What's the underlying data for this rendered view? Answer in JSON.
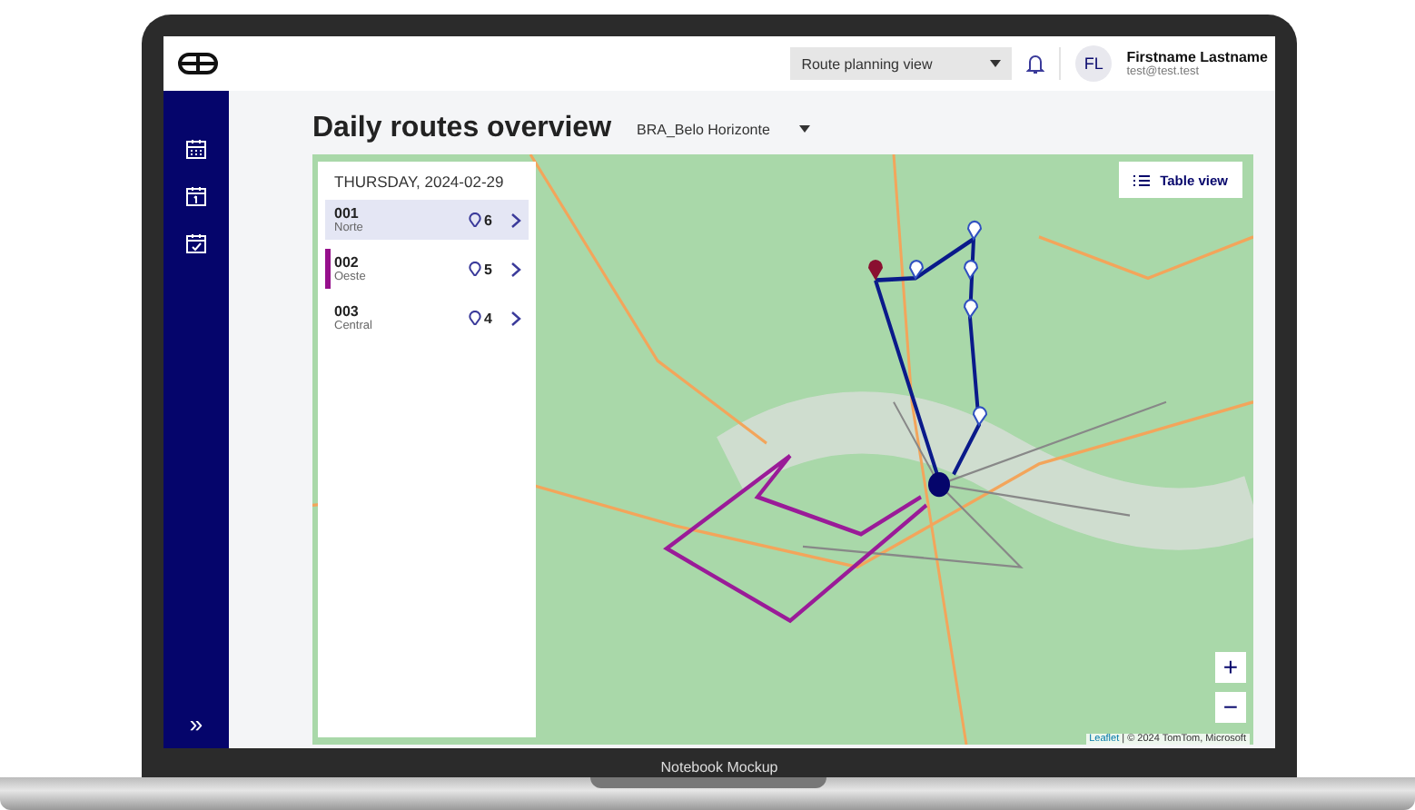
{
  "header": {
    "view_select": "Route planning view",
    "user": {
      "initials": "FL",
      "name": "Firstname Lastname",
      "email": "test@test.test"
    }
  },
  "sidebar": {
    "expand": "»"
  },
  "page": {
    "title": "Daily routes overview",
    "region_select": "BRA_Belo Horizonte"
  },
  "routes_panel": {
    "date": "THURSDAY, 2024-02-29",
    "routes": [
      {
        "id": "001",
        "area": "Norte",
        "stops": "6",
        "selected": true,
        "flagged": false
      },
      {
        "id": "002",
        "area": "Oeste",
        "stops": "5",
        "selected": false,
        "flagged": true
      },
      {
        "id": "003",
        "area": "Central",
        "stops": "4",
        "selected": false,
        "flagged": false
      }
    ]
  },
  "map": {
    "table_view": "Table view",
    "zoom_in": "+",
    "zoom_out": "−",
    "attribution_link": "Leaflet",
    "attribution": "| © 2024 TomTom, Microsoft"
  },
  "frame": {
    "label": "Notebook Mockup"
  }
}
